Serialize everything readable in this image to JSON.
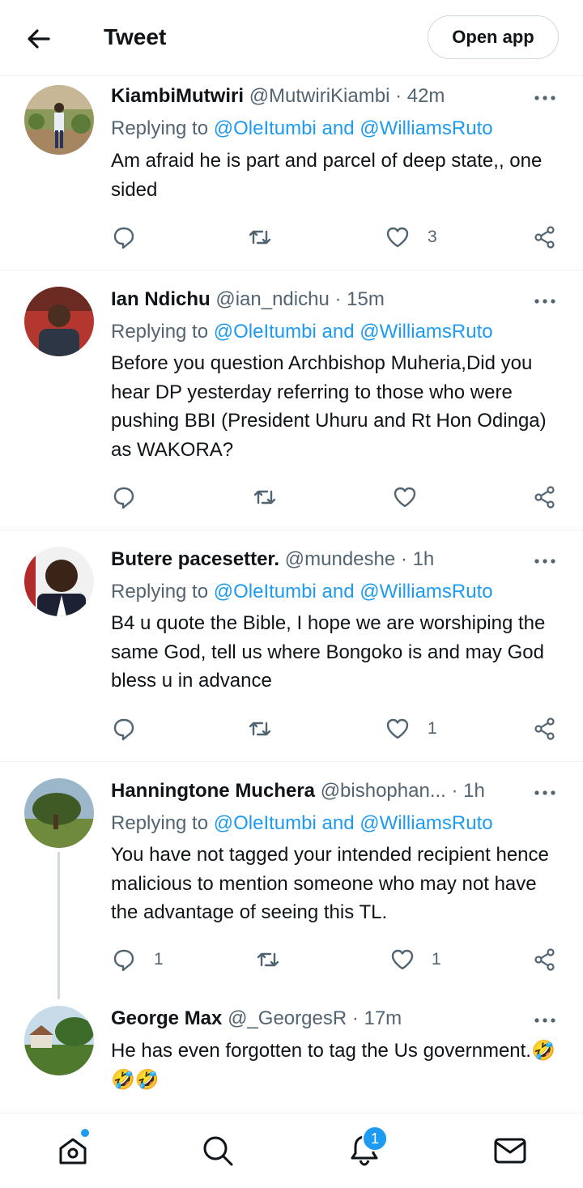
{
  "header": {
    "title": "Tweet",
    "open_app": "Open app"
  },
  "tweets": [
    {
      "name": "KiambiMutwiri",
      "handle": "@MutwiriKiambi",
      "time": "· 42m",
      "replying_prefix": "Replying to",
      "mention1": "@OleItumbi",
      "and": "and",
      "mention2": "@WilliamsRuto",
      "text": "Am afraid he is part and parcel of deep state,, one sided",
      "counts": {
        "replies": "",
        "retweets": "",
        "likes": "3"
      }
    },
    {
      "name": "Ian Ndichu",
      "handle": "@ian_ndichu",
      "time": "· 15m",
      "replying_prefix": "Replying to",
      "mention1": "@OleItumbi",
      "and": "and",
      "mention2": "@WilliamsRuto",
      "text": "Before you question Archbishop Muheria,Did you hear DP yesterday referring to those who were pushing BBI (President Uhuru and Rt Hon Odinga) as WAKORA?",
      "counts": {
        "replies": "",
        "retweets": "",
        "likes": ""
      }
    },
    {
      "name": "Butere pacesetter.",
      "handle": "@mundeshe",
      "time": "· 1h",
      "replying_prefix": "Replying to",
      "mention1": "@OleItumbi",
      "and": "and",
      "mention2": "@WilliamsRuto",
      "text": "B4 u quote the Bible, I hope we are worshiping the same God, tell us where Bongoko is and may God bless u in advance",
      "counts": {
        "replies": "",
        "retweets": "",
        "likes": "1"
      }
    },
    {
      "name": "Hanningtone Muchera",
      "handle": "@bishophan...",
      "time": "· 1h",
      "replying_prefix": "Replying to",
      "mention1": "@OleItumbi",
      "and": "and",
      "mention2": "@WilliamsRuto",
      "text": "You have not tagged your intended recipient hence malicious to mention someone who may not have the advantage of seeing this TL.",
      "counts": {
        "replies": "1",
        "retweets": "",
        "likes": "1"
      }
    },
    {
      "name": "George Max",
      "handle": "@_GeorgesR",
      "time": "· 17m",
      "text": "He has even forgotten to tag the Us government.🤣🤣🤣"
    }
  ],
  "icons": {
    "back": "arrow-left-icon",
    "more": "more-horizontal-icon",
    "reply": "reply-icon",
    "retweet": "retweet-icon",
    "like": "heart-icon",
    "share": "share-icon",
    "home": "home-icon",
    "search": "search-icon",
    "notifications": "bell-icon",
    "messages": "mail-icon"
  },
  "bottom_nav": {
    "notifications_badge": "1"
  },
  "colors": {
    "accent": "#1d9bf0",
    "text": "#0f1419",
    "secondary": "#536471"
  }
}
